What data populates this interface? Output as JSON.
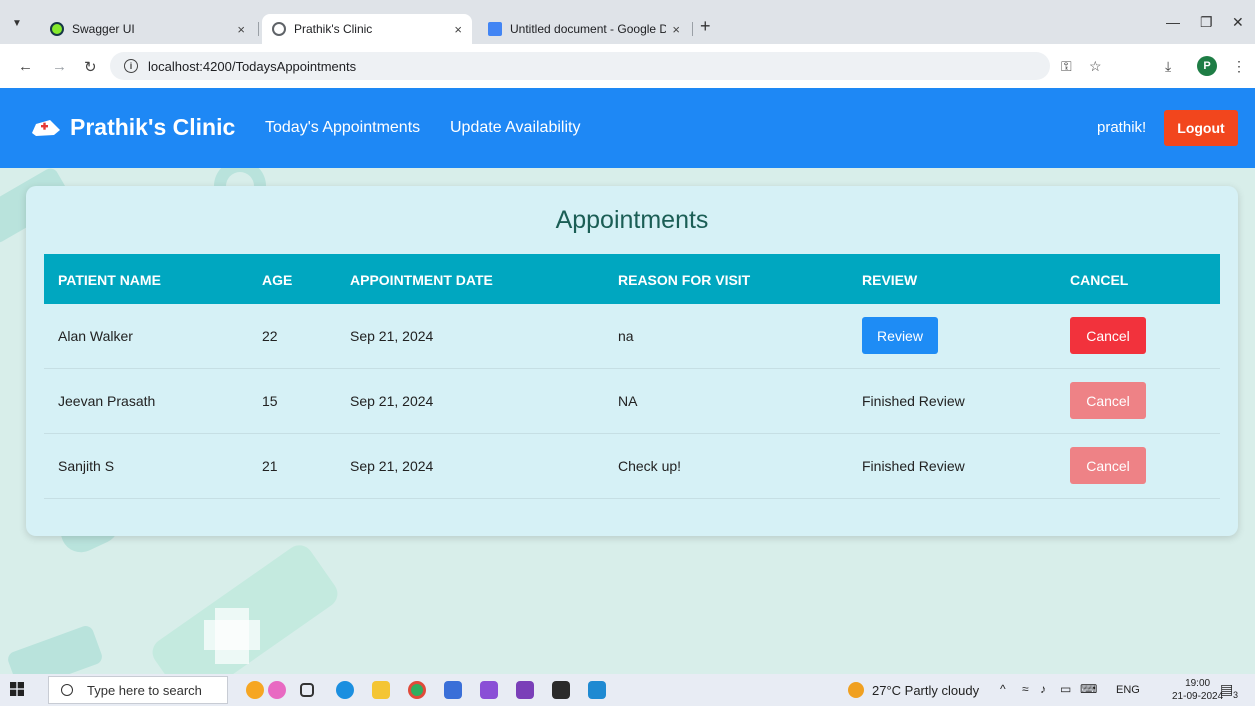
{
  "browser": {
    "tabs": [
      {
        "label": "Swagger UI",
        "active": false,
        "favicon_color": "#85ea2d"
      },
      {
        "label": "Prathik's Clinic",
        "active": true,
        "favicon_color": "#5f6368"
      },
      {
        "label": "Untitled document - Google Do",
        "active": false,
        "favicon_color": "#4285f4"
      }
    ],
    "new_tab": "+",
    "close_glyph": "×",
    "url": "localhost:4200/TodaysAppointments",
    "profile_initial": "P"
  },
  "app": {
    "brand": "Prathik's Clinic",
    "nav": [
      "Today's Appointments",
      "Update Availability"
    ],
    "username": "prathik!",
    "logout_label": "Logout",
    "colors": {
      "nav_bg": "#1e88f5",
      "logout_bg": "#f2461d",
      "header_bg": "#00a7c0",
      "review_btn": "#1e8cf5",
      "cancel_btn": "#f2323c",
      "cancel_disabled": "#ee8286"
    }
  },
  "appointments": {
    "title": "Appointments",
    "columns": [
      "PATIENT NAME",
      "AGE",
      "APPOINTMENT DATE",
      "REASON FOR VISIT",
      "REVIEW",
      "CANCEL"
    ],
    "rows": [
      {
        "name": "Alan Walker",
        "age": "22",
        "date": "Sep 21, 2024",
        "reason": "na",
        "review": "Review",
        "review_is_button": true,
        "cancel": "Cancel",
        "cancel_enabled": true
      },
      {
        "name": "Jeevan Prasath",
        "age": "15",
        "date": "Sep 21, 2024",
        "reason": "NA",
        "review": "Finished Review",
        "review_is_button": false,
        "cancel": "Cancel",
        "cancel_enabled": false
      },
      {
        "name": "Sanjith S",
        "age": "21",
        "date": "Sep 21, 2024",
        "reason": "Check up!",
        "review": "Finished Review",
        "review_is_button": false,
        "cancel": "Cancel",
        "cancel_enabled": false
      }
    ]
  },
  "taskbar": {
    "search_placeholder": "Type here to search",
    "weather": "27°C  Partly cloudy",
    "language": "ENG",
    "time": "19:00",
    "date": "21-09-2024",
    "notification_count": "3"
  }
}
